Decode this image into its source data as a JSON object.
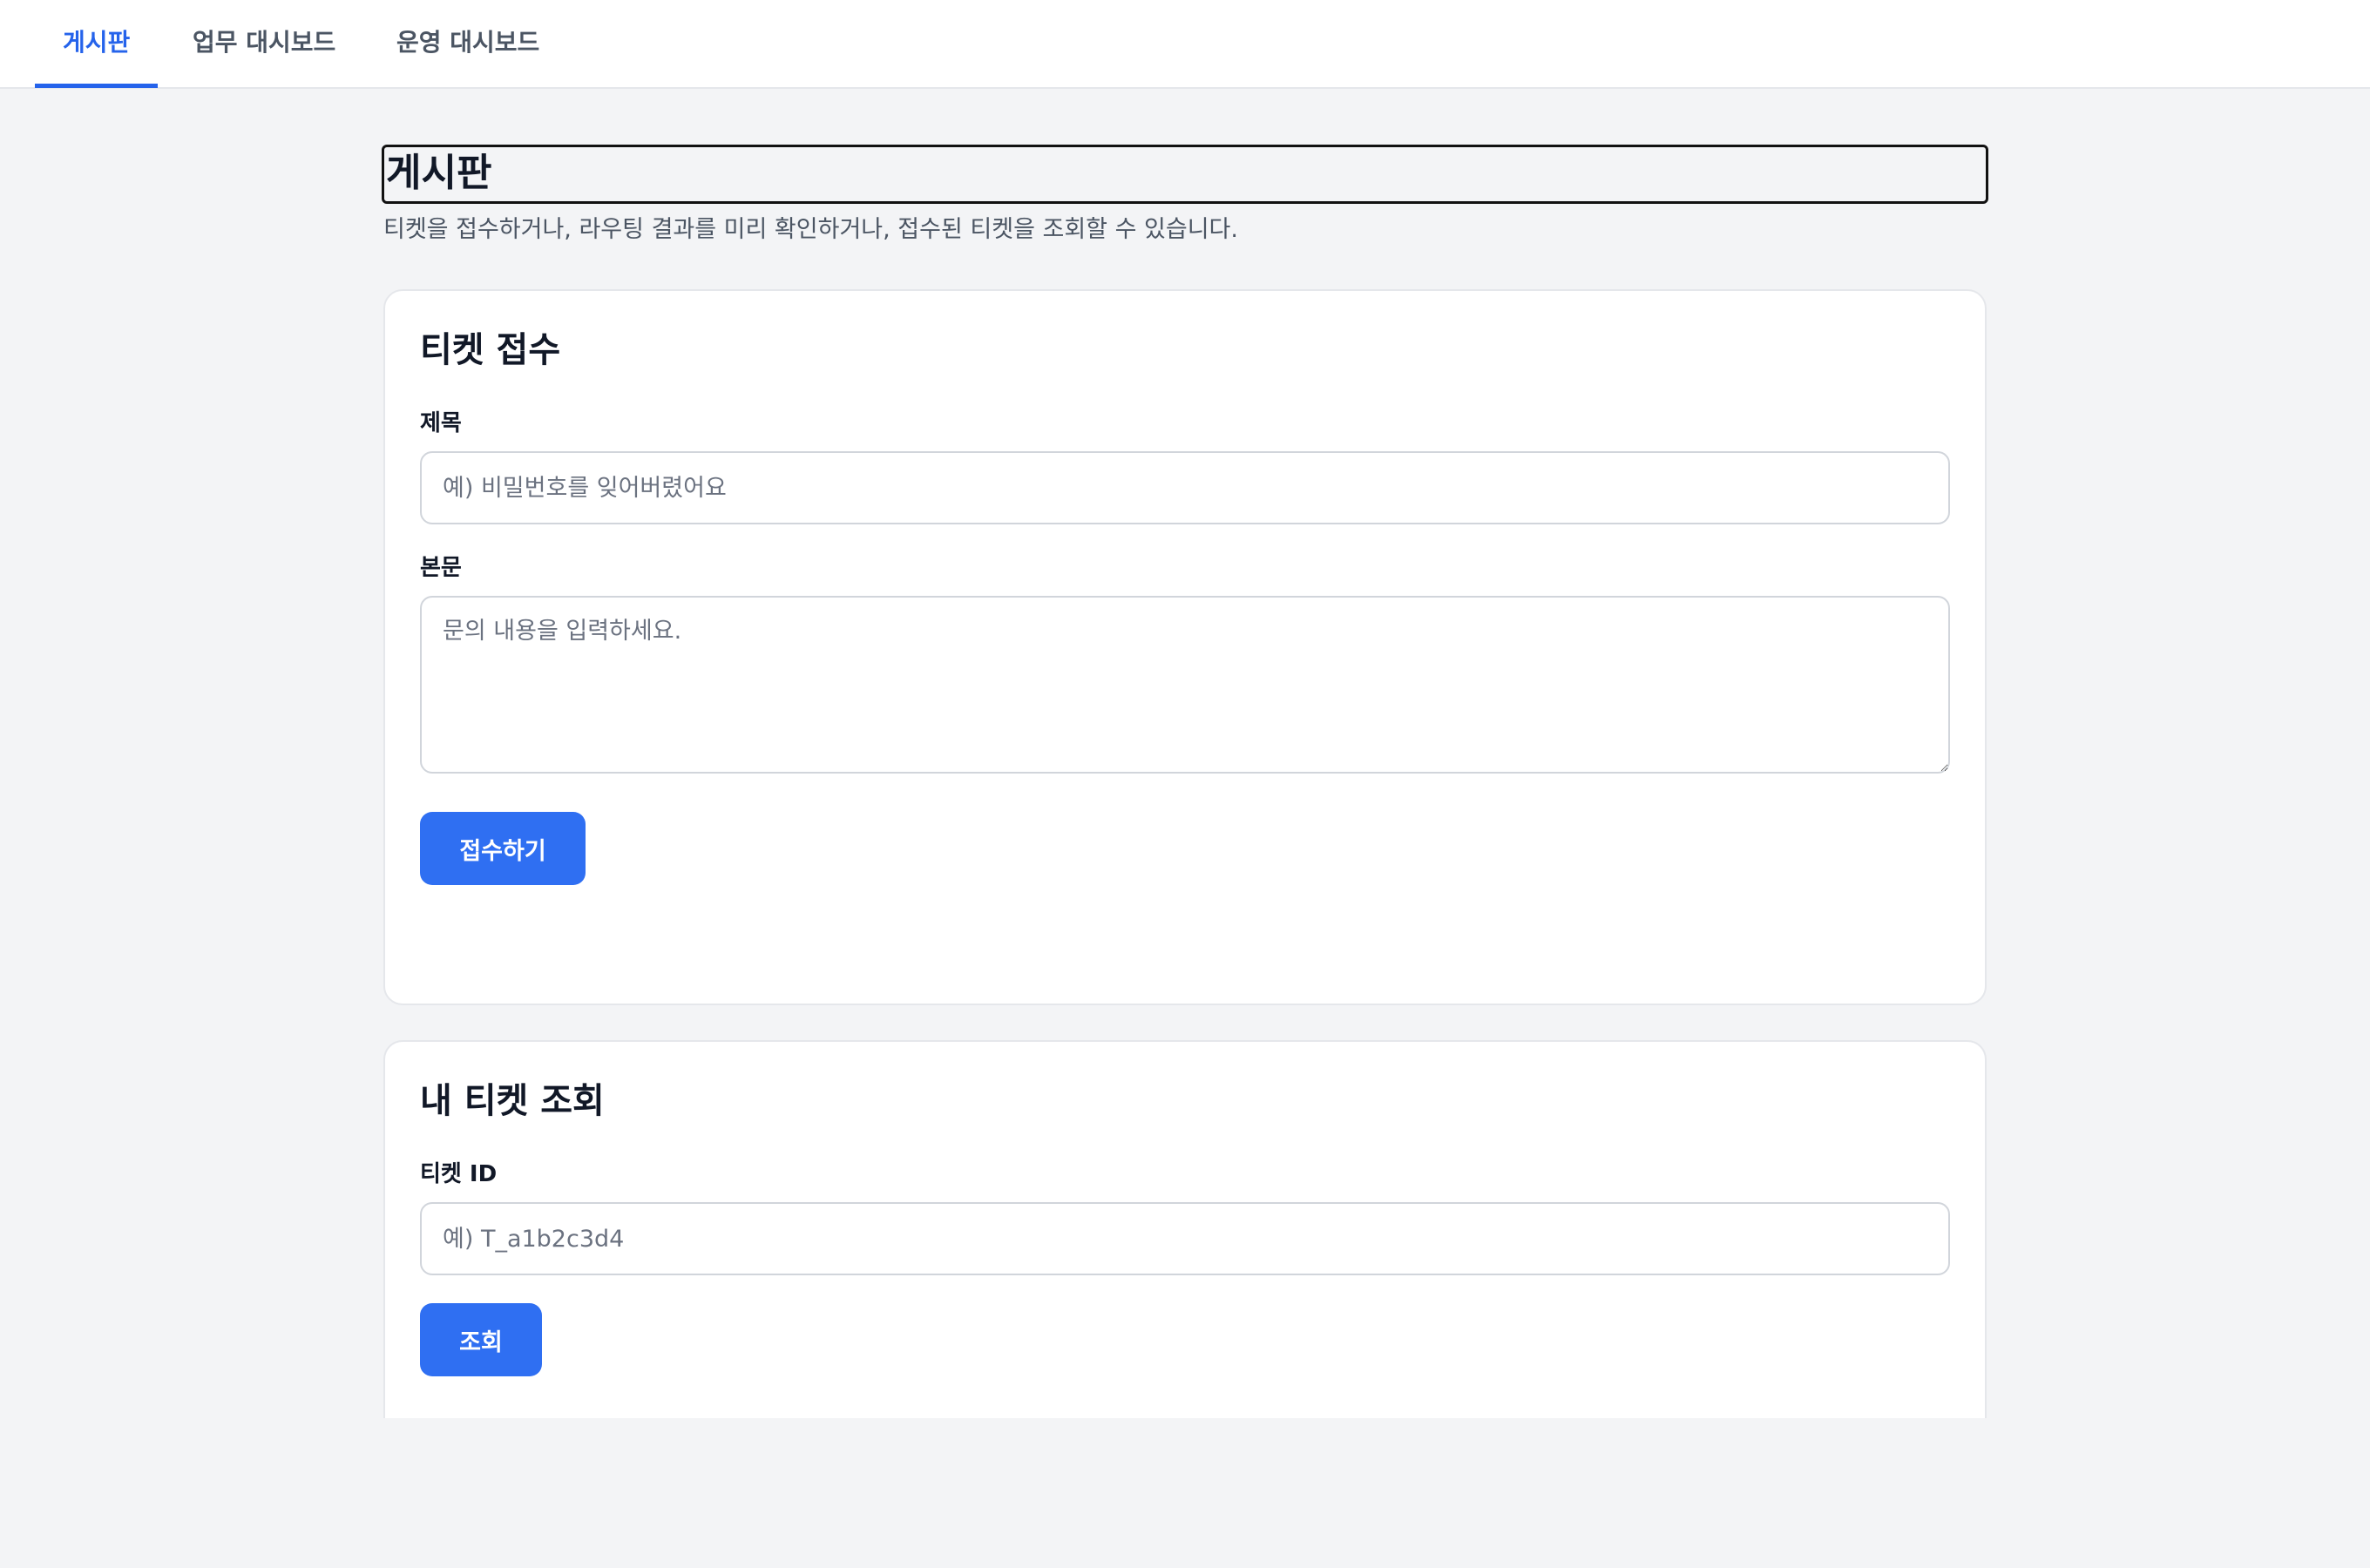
{
  "nav": {
    "tabs": [
      {
        "label": "게시판",
        "active": true
      },
      {
        "label": "업무 대시보드",
        "active": false
      },
      {
        "label": "운영 대시보드",
        "active": false
      }
    ],
    "accent_color": "#2563eb"
  },
  "header": {
    "title": "게시판",
    "description": "티켓을 접수하거나, 라우팅 결과를 미리 확인하거나, 접수된 티켓을 조회할 수 있습니다."
  },
  "intake": {
    "title": "티켓 접수",
    "subject_label": "제목",
    "subject_value": "",
    "subject_placeholder": "예) 비밀번호를 잊어버렸어요",
    "body_label": "본문",
    "body_value": "",
    "body_placeholder": "문의 내용을 입력하세요.",
    "submit_label": "접수하기"
  },
  "lookup": {
    "title": "내 티켓 조회",
    "ticket_id_label": "티켓 ID",
    "ticket_id_value": "",
    "ticket_id_placeholder": "예) T_a1b2c3d4",
    "search_label": "조회"
  },
  "colors": {
    "page_background": "#f3f4f6",
    "primary_button": "#2f6ff2"
  }
}
